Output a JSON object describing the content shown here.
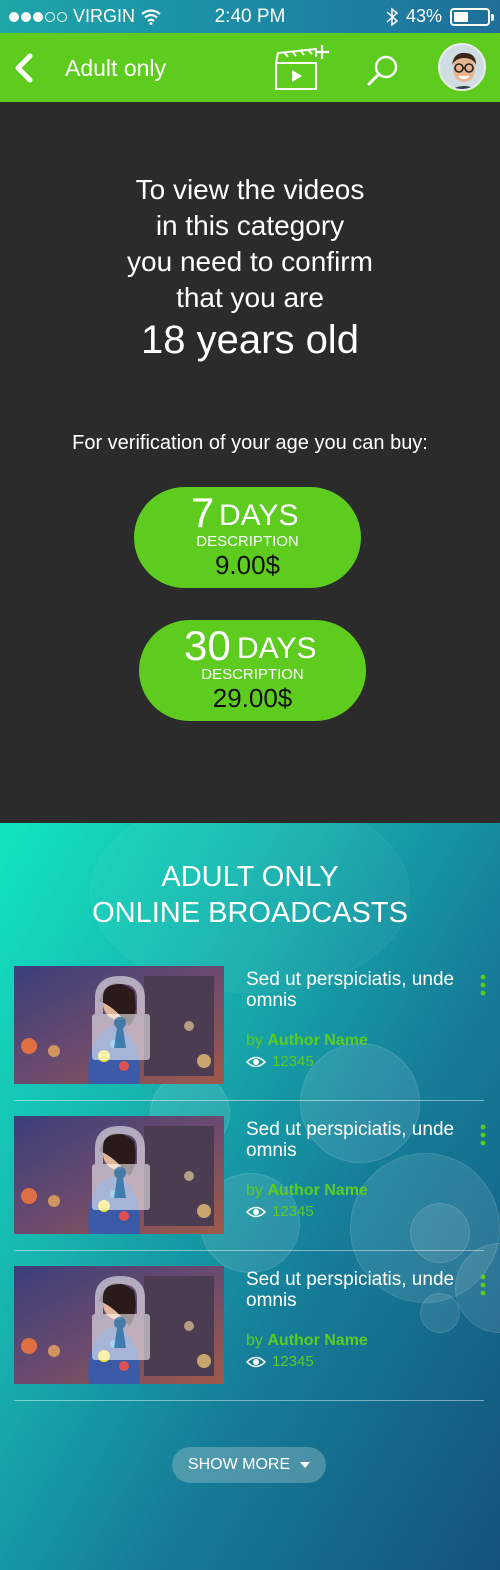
{
  "status_bar": {
    "carrier": "VIRGIN",
    "time": "2:40 PM",
    "battery_percent": "43%",
    "battery_level": 0.43
  },
  "app_bar": {
    "title": "Adult only",
    "icons": [
      "back-icon",
      "add-video-icon",
      "search-icon",
      "avatar"
    ]
  },
  "age_gate": {
    "message_lines": [
      "To view the videos",
      "in this category",
      "you need to confirm",
      "that you are"
    ],
    "age_text": "18 years old",
    "verify_text": "For verification of your age you can buy:",
    "plans": [
      {
        "number": "7",
        "unit": "DAYS",
        "description": "DESCRIPTION",
        "price": "9.00$"
      },
      {
        "number": "30",
        "unit": "DAYS",
        "description": "DESCRIPTION",
        "price": "29.00$"
      }
    ]
  },
  "broadcasts": {
    "title_lines": [
      "ADULT ONLY",
      "ONLINE BROADCASTS"
    ],
    "items": [
      {
        "title": "Sed ut perspiciatis, unde omnis",
        "by": "by",
        "author": "Author Name",
        "views": "12345"
      },
      {
        "title": "Sed ut perspiciatis, unde omnis",
        "by": "by",
        "author": "Author Name",
        "views": "12345"
      },
      {
        "title": "Sed ut perspiciatis, unde omnis",
        "by": "by",
        "author": "Author Name",
        "views": "12345"
      }
    ],
    "show_more": "SHOW MORE"
  },
  "colors": {
    "accent": "#5dcc1f",
    "dark_bg": "#2b2b2b",
    "teal_start": "#11e4c0",
    "navy_end": "#14527c"
  }
}
